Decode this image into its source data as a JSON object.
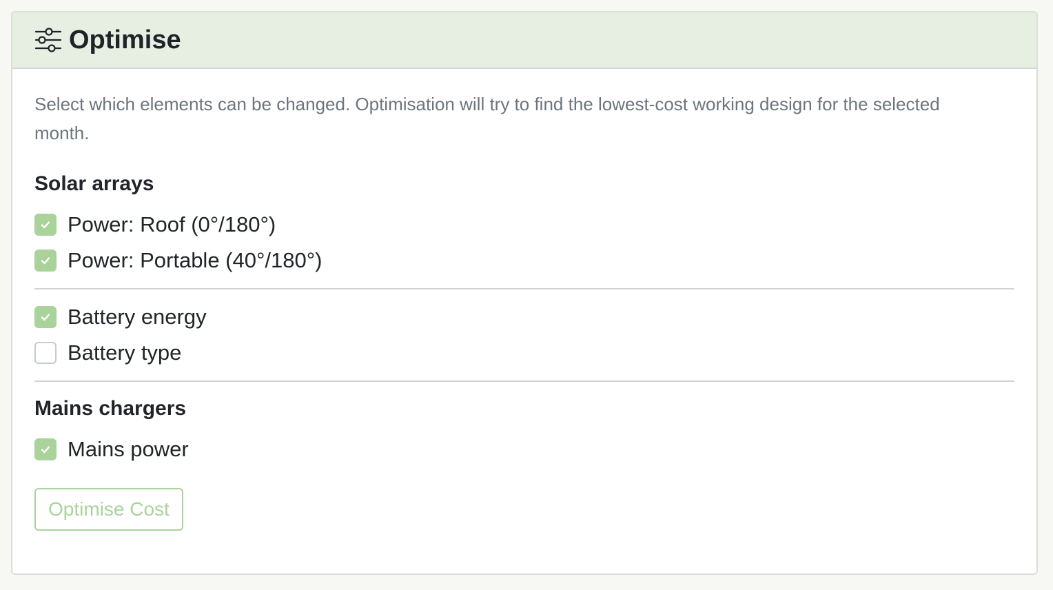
{
  "panel": {
    "title": "Optimise",
    "icon": "sliders-icon",
    "description": "Select which elements can be changed. Optimisation will try to find the lowest-cost working design for the selected month."
  },
  "sections": {
    "solar": {
      "heading": "Solar arrays",
      "items": [
        {
          "label": "Power: Roof (0°/180°)",
          "checked": true
        },
        {
          "label": "Power: Portable (40°/180°)",
          "checked": true
        }
      ]
    },
    "battery": {
      "items": [
        {
          "label": "Battery energy",
          "checked": true
        },
        {
          "label": "Battery type",
          "checked": false
        }
      ]
    },
    "mains": {
      "heading": "Mains chargers",
      "items": [
        {
          "label": "Mains power",
          "checked": true
        }
      ]
    }
  },
  "actions": {
    "optimise_label": "Optimise Cost"
  },
  "colors": {
    "header_bg": "#e6efe2",
    "accent": "#a9d39a",
    "muted_text": "#6c757d"
  }
}
